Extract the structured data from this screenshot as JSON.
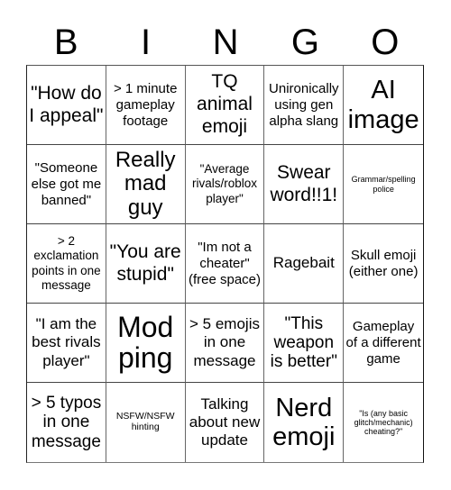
{
  "header": {
    "letters": [
      "B",
      "I",
      "N",
      "G",
      "O"
    ]
  },
  "cells": [
    "\"How do I appeal\"",
    "> 1 minute gameplay footage",
    "TQ animal emoji",
    "Unironically using gen alpha slang",
    "AI image",
    "\"Someone else got me banned\"",
    "Really mad guy",
    "\"Average rivals/roblox player\"",
    "Swear word!!1!",
    "Grammar/spelling police",
    "> 2 exclamation points in one message",
    "\"You are stupid\"",
    "\"Im not a cheater\" (free space)",
    "Ragebait",
    "Skull emoji (either one)",
    "\"I am the best rivals player\"",
    "Mod ping",
    "> 5 emojis in one message",
    "\"This weapon is better\"",
    "Gameplay of a different game",
    "> 5 typos in one message",
    "NSFW/NSFW hinting",
    "Talking about new update",
    "Nerd emoji",
    "\"Is (any basic glitch/mechanic) cheating?\""
  ]
}
